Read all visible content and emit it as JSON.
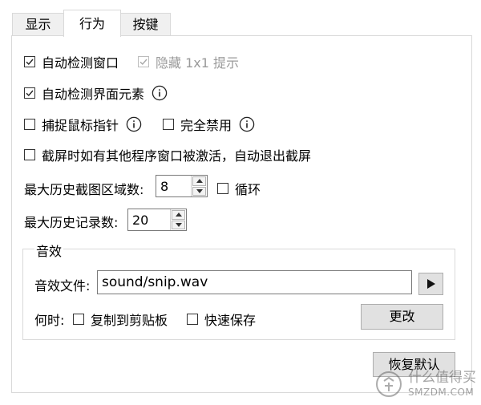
{
  "tabs": [
    {
      "label": "显示",
      "active": false
    },
    {
      "label": "行为",
      "active": true
    },
    {
      "label": "按键",
      "active": false
    }
  ],
  "options": {
    "auto_detect_window": {
      "label": "自动检测窗口",
      "checked": true
    },
    "hide_1x1_hint": {
      "label": "隐藏 1x1 提示",
      "checked": true,
      "disabled": true
    },
    "auto_detect_elements": {
      "label": "自动检测界面元素",
      "checked": true
    },
    "capture_cursor": {
      "label": "捕捉鼠标指针",
      "checked": false
    },
    "disable_completely": {
      "label": "完全禁用",
      "checked": false
    },
    "auto_exit": {
      "label": "截屏时如有其他程序窗口被激活，自动退出截屏",
      "checked": false
    }
  },
  "history": {
    "max_regions_label": "最大历史截图区域数:",
    "max_regions_value": "8",
    "loop": {
      "label": "循环",
      "checked": false
    },
    "max_records_label": "最大历史记录数:",
    "max_records_value": "20"
  },
  "sound": {
    "group_title": "音效",
    "file_label": "音效文件:",
    "file_value": "sound/snip.wav",
    "when_label": "何时:",
    "copy_clipboard": {
      "label": "复制到剪贴板",
      "checked": false
    },
    "quick_save": {
      "label": "快速保存",
      "checked": false
    },
    "change_button": "更改"
  },
  "restore_defaults_button": "恢复默认",
  "watermark": {
    "line1": "什么值得买",
    "line2": "SMZDM.COM"
  }
}
